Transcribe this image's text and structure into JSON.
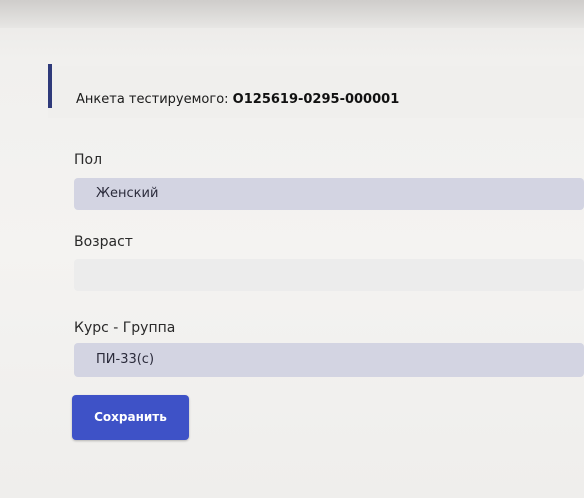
{
  "header": {
    "title_prefix": "Анкета тестируемого:",
    "code": "О125619-0295-000001"
  },
  "form": {
    "gender": {
      "label": "Пол",
      "value": "Женский"
    },
    "age": {
      "label": "Возраст",
      "value": ""
    },
    "course_group": {
      "label": "Курс - Группа",
      "value": "ПИ-33(с)"
    },
    "save_label": "Сохранить"
  },
  "colors": {
    "accent": "#2f3a7a",
    "button": "#3e52c7",
    "field_fill": "#d3d4e2"
  }
}
